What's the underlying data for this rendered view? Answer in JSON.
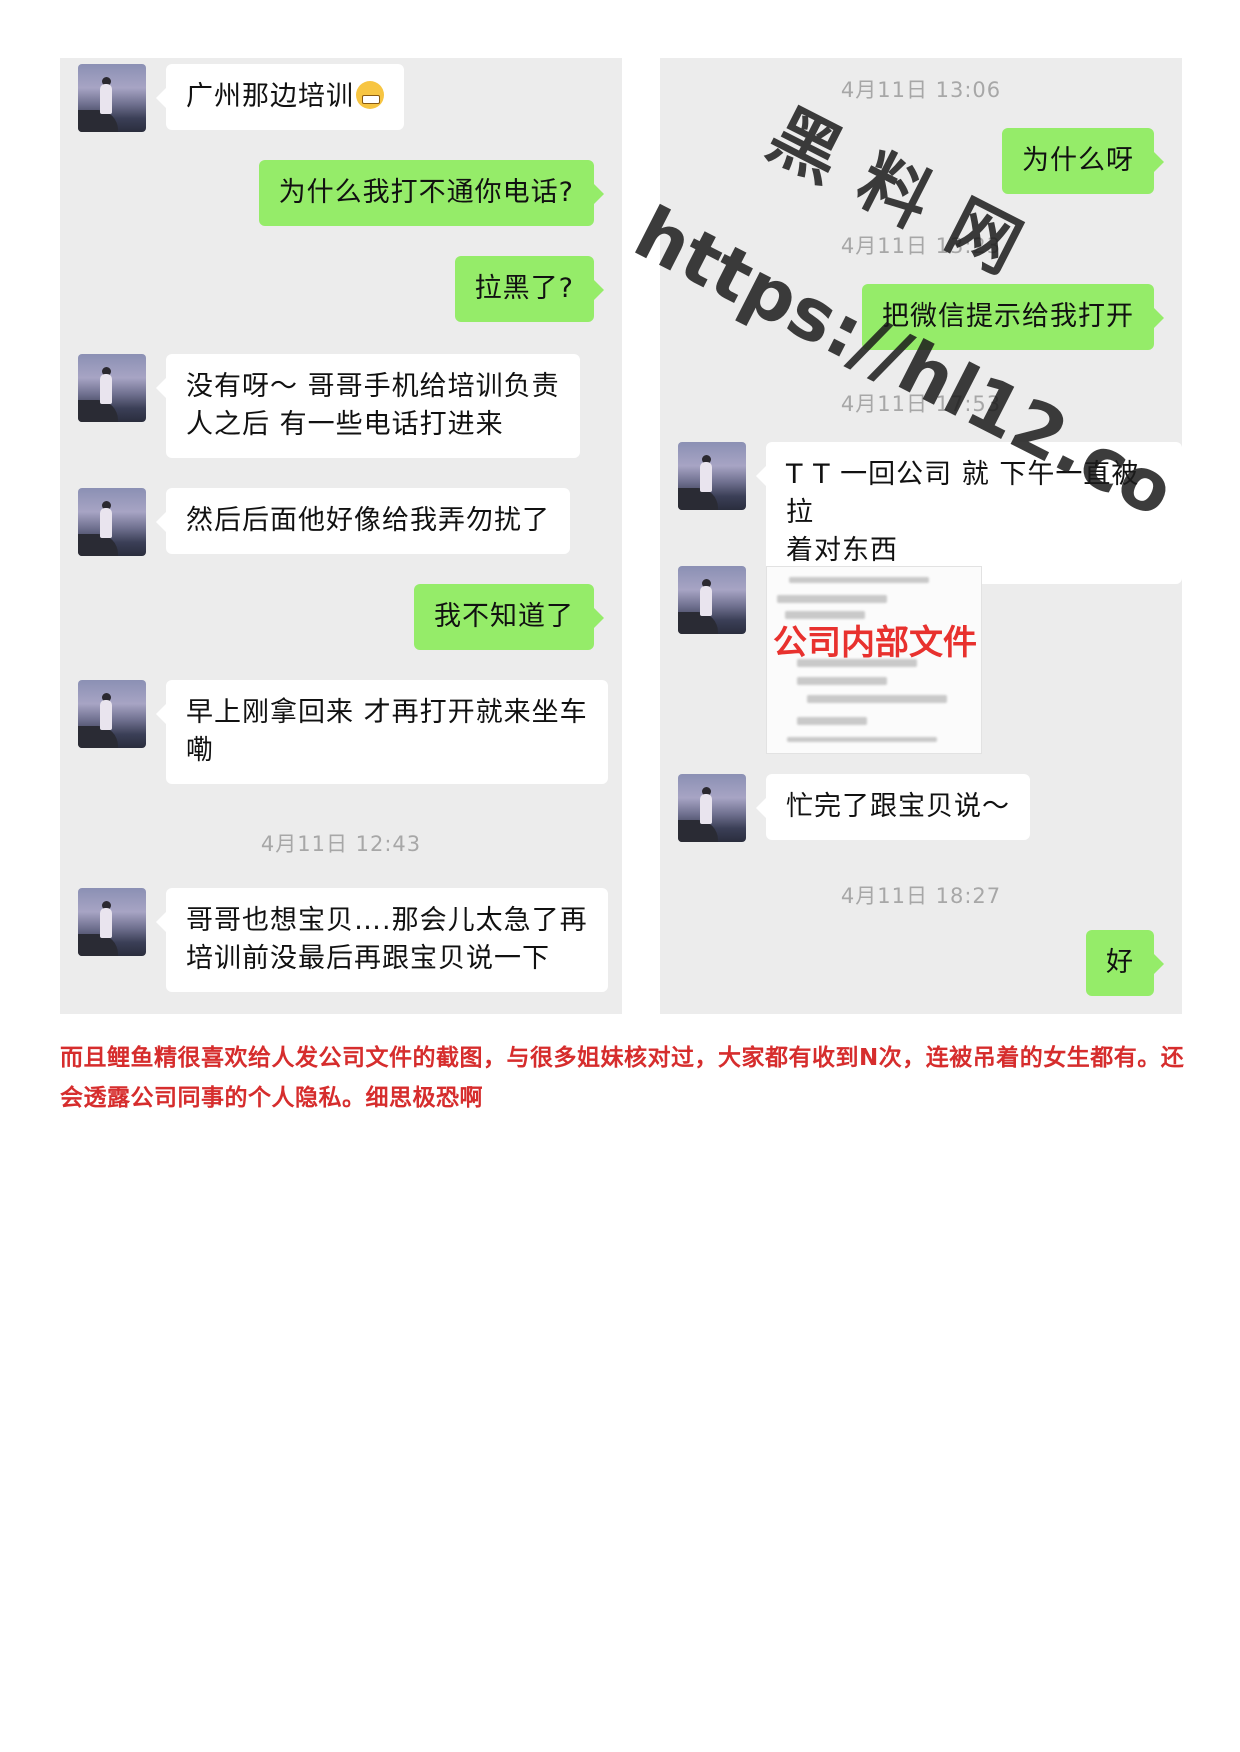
{
  "left_chat": {
    "messages": [
      {
        "dir": "in",
        "text": "广州那边培训",
        "emoji": "grimacing-face"
      },
      {
        "dir": "out",
        "text": "为什么我打不通你电话?"
      },
      {
        "dir": "out",
        "text": "拉黑了?"
      },
      {
        "dir": "in",
        "text": "没有呀～ 哥哥手机给培训负责\n人之后 有一些电话打进来"
      },
      {
        "dir": "in",
        "text": "然后后面他好像给我弄勿扰了"
      },
      {
        "dir": "out",
        "text": "我不知道了"
      },
      {
        "dir": "in",
        "text": "早上刚拿回来 才再打开就来坐车\n嘞"
      },
      {
        "dir": "in",
        "text": "哥哥也想宝贝….那会儿太急了再\n培训前没最后再跟宝贝说一下"
      }
    ],
    "timestamp": "4月11日 12:43"
  },
  "right_chat": {
    "timestamps": [
      "4月11日 13:06",
      "4月11日 13:23",
      "4月11日 17:53",
      "4月11日 18:27"
    ],
    "messages": [
      {
        "dir": "out",
        "text": "为什么呀"
      },
      {
        "dir": "out",
        "text": "把微信提示给我打开"
      },
      {
        "dir": "in",
        "text": "T T 一回公司 就 下午一直被拉\n着对东西"
      },
      {
        "dir": "in",
        "text": "忙完了跟宝贝说～"
      },
      {
        "dir": "out",
        "text": "好"
      }
    ],
    "document_label": "公司内部文件"
  },
  "watermark": {
    "top_text": "黑料网",
    "url_text": "https://hl12.co"
  },
  "caption": "而且鲤鱼精很喜欢给人发公司文件的截图，与很多姐妹核对过，大家都有收到N次，连被吊着的女生都有。还会透露公司同事的个人隐私。细思极恐啊",
  "colors": {
    "panel_bg": "#ececec",
    "outgoing_bubble": "#95ec69",
    "incoming_bubble": "#ffffff",
    "caption_red": "#d62d2d",
    "doc_label_red": "#e8312e"
  }
}
